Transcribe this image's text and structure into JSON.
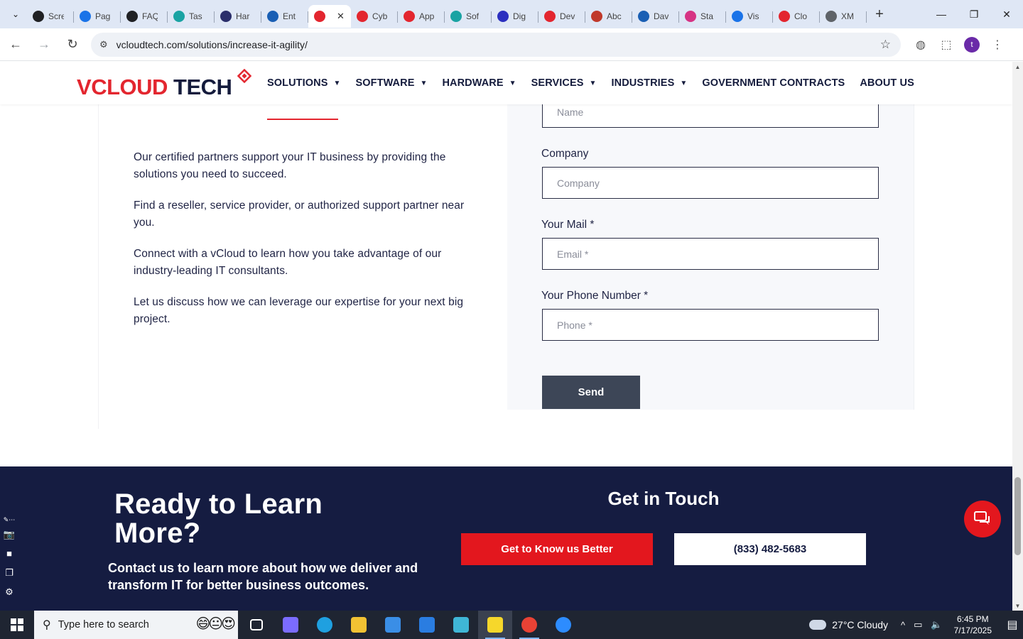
{
  "browser": {
    "tabs": [
      {
        "title": "Scre",
        "color": "#202124"
      },
      {
        "title": "Pag",
        "color": "#1a73e8"
      },
      {
        "title": "FAQ",
        "color": "#202124"
      },
      {
        "title": "Tas",
        "color": "#1aa3a3"
      },
      {
        "title": "Har",
        "color": "#2b2f6b"
      },
      {
        "title": "Ent",
        "color": "#1a5fb4"
      },
      {
        "title": "",
        "color": "#e3262f",
        "active": true
      },
      {
        "title": "Cyb",
        "color": "#e3262f"
      },
      {
        "title": "App",
        "color": "#e3262f"
      },
      {
        "title": "Sof",
        "color": "#1aa3a3"
      },
      {
        "title": "Dig",
        "color": "#2b2fbf"
      },
      {
        "title": "Dev",
        "color": "#e3262f"
      },
      {
        "title": "Abc",
        "color": "#c0392b"
      },
      {
        "title": "Dav",
        "color": "#1a5fb4"
      },
      {
        "title": "Sta",
        "color": "#d63384"
      },
      {
        "title": "Vis",
        "color": "#1a73e8"
      },
      {
        "title": "Clo",
        "color": "#e3262f"
      },
      {
        "title": "XM",
        "color": "#5f6368"
      }
    ],
    "active_tab_close": "✕",
    "new_tab": "+",
    "url": "vcloudtech.com/solutions/increase-it-agility/",
    "profile_initial": "t"
  },
  "site": {
    "logo": {
      "v": "V",
      "cloud": "CLOUD",
      "tech": " TECH"
    },
    "nav": [
      {
        "label": "SOLUTIONS",
        "caret": true
      },
      {
        "label": "SOFTWARE",
        "caret": true
      },
      {
        "label": "HARDWARE",
        "caret": true
      },
      {
        "label": "SERVICES",
        "caret": true
      },
      {
        "label": "INDUSTRIES",
        "caret": true
      },
      {
        "label": "GOVERNMENT CONTRACTS",
        "caret": false
      },
      {
        "label": "ABOUT US",
        "caret": false
      }
    ],
    "intro": [
      "Our certified partners support your IT business by providing the solutions you need to succeed.",
      "Find a reseller, service provider, or authorized support partner near you.",
      "Connect with a vCloud to learn how you take advantage of our industry-leading IT consultants.",
      "Let us discuss how we can leverage our expertise for your next big project."
    ],
    "form": {
      "name_placeholder": "Name",
      "company_label": "Company",
      "company_placeholder": "Company",
      "mail_label": "Your Mail *",
      "mail_placeholder": "Email *",
      "phone_label": "Your Phone Number *",
      "phone_placeholder": "Phone *",
      "send_label": "Send"
    },
    "cta": {
      "heading": "Ready to Learn More?",
      "sub": "Contact us to learn more about how we deliver and transform IT for better business outcomes.",
      "touch_heading": "Get in Touch",
      "know_button": "Get to Know us Better",
      "phone_button": "(833) 482-5683"
    }
  },
  "taskbar": {
    "search_placeholder": "Type here to search",
    "weather": "27°C  Cloudy",
    "time": "6:45 PM",
    "date": "7/17/2025",
    "apps": [
      {
        "name": "task-view",
        "color": "#ffffff"
      },
      {
        "name": "copilot",
        "color": "#7b6cff"
      },
      {
        "name": "edge",
        "color": "#1fa0e0"
      },
      {
        "name": "file-explorer",
        "color": "#f2c233"
      },
      {
        "name": "store",
        "color": "#3a8ee6"
      },
      {
        "name": "mail",
        "color": "#2a7de1"
      },
      {
        "name": "app-diamond",
        "color": "#3fb6d6"
      },
      {
        "name": "sticky-notes",
        "color": "#f6d72b"
      },
      {
        "name": "chrome",
        "color": "#e94235"
      },
      {
        "name": "zoom",
        "color": "#2d8cff"
      }
    ]
  }
}
